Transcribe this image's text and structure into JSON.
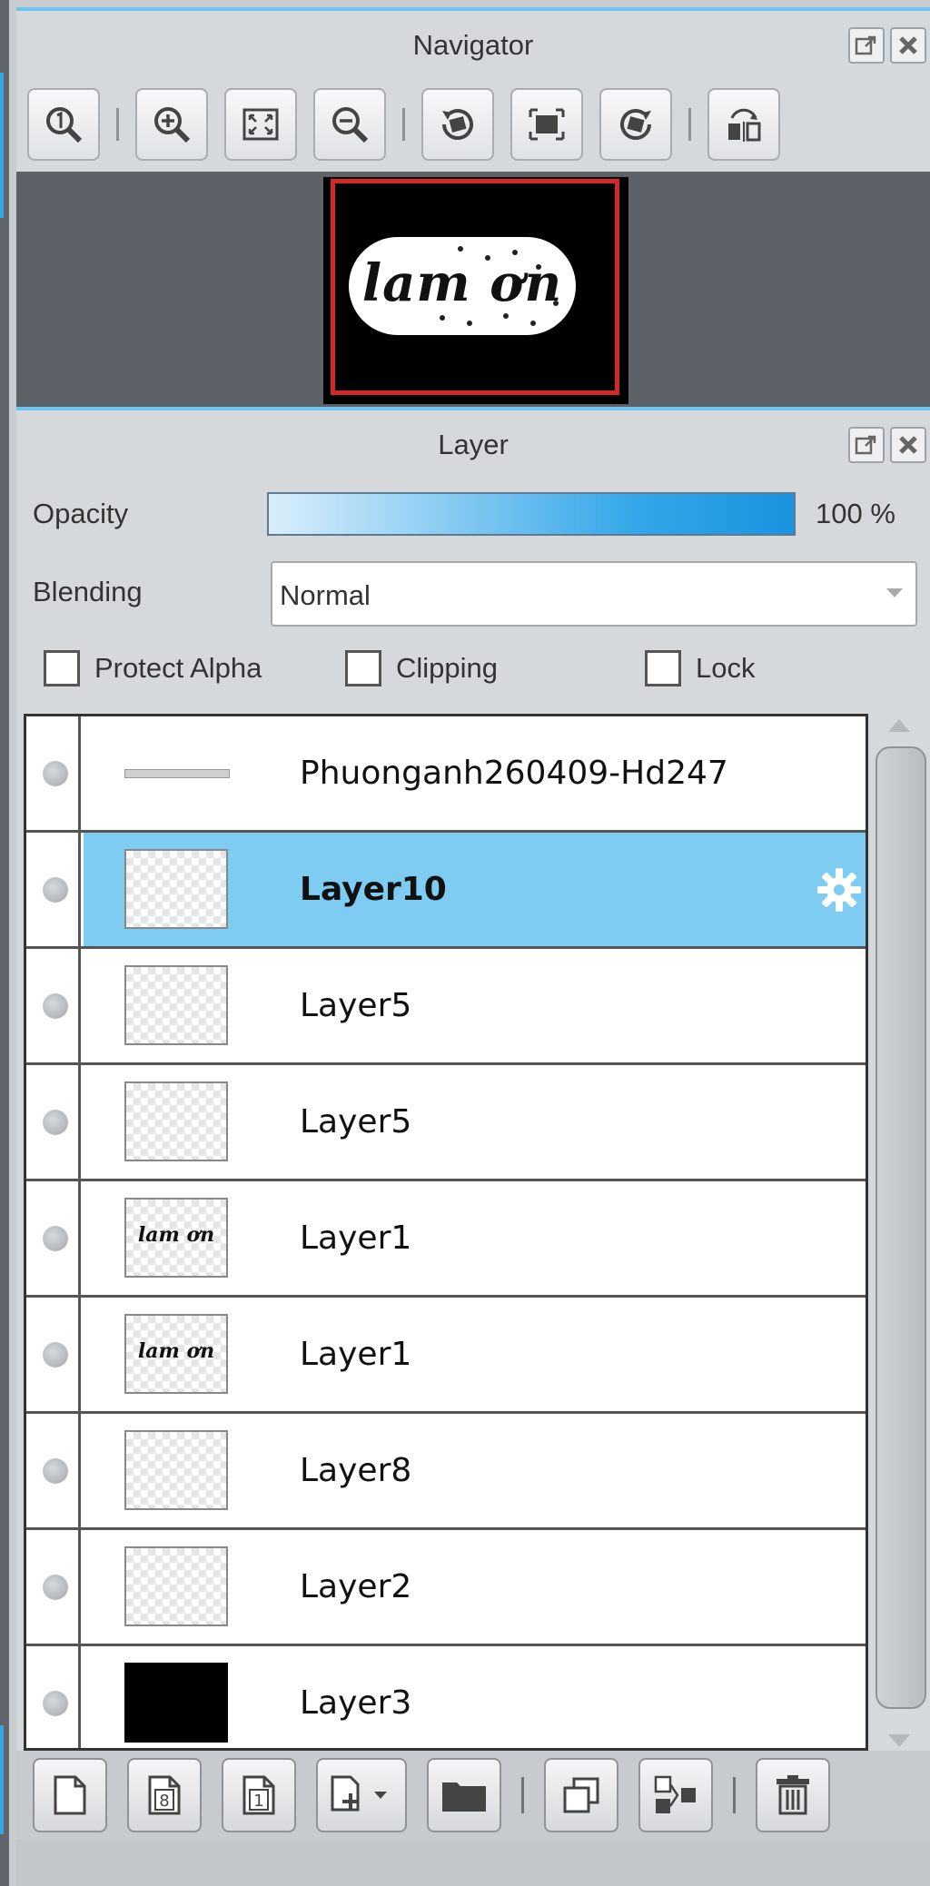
{
  "navigator": {
    "title": "Navigator",
    "toolbar": [
      {
        "name": "zoom-actual-icon"
      },
      {
        "name": "zoom-in-icon"
      },
      {
        "name": "fit-to-window-icon"
      },
      {
        "name": "zoom-out-icon"
      },
      {
        "name": "rotate-left-icon"
      },
      {
        "name": "fit-canvas-icon"
      },
      {
        "name": "rotate-right-icon"
      },
      {
        "name": "flip-horizontal-icon"
      }
    ],
    "preview": {
      "art_text": "lam ơn"
    }
  },
  "layer_panel": {
    "title": "Layer",
    "opacity_label": "Opacity",
    "opacity_value": "100 %",
    "opacity_fraction": 1.0,
    "blending_label": "Blending",
    "blending_value": "Normal",
    "protect_alpha_label": "Protect Alpha",
    "clipping_label": "Clipping",
    "lock_label": "Lock",
    "layers": [
      {
        "name": "Phuonganh260409-Hd247",
        "thumb": "line",
        "selected": false
      },
      {
        "name": "Layer10",
        "thumb": "transparent",
        "selected": true
      },
      {
        "name": "Layer5",
        "thumb": "transparent",
        "selected": false
      },
      {
        "name": "Layer5",
        "thumb": "transparent",
        "selected": false
      },
      {
        "name": "Layer1",
        "thumb": "text",
        "thumb_text": "lam ơn",
        "selected": false
      },
      {
        "name": "Layer1",
        "thumb": "text",
        "thumb_text": "lam ơn",
        "selected": false
      },
      {
        "name": "Layer8",
        "thumb": "transparent",
        "selected": false
      },
      {
        "name": "Layer2",
        "thumb": "transparent",
        "selected": false
      },
      {
        "name": "Layer3",
        "thumb": "black",
        "selected": false
      }
    ],
    "bottom_toolbar": [
      {
        "name": "new-layer-icon"
      },
      {
        "name": "new-8bit-layer-icon"
      },
      {
        "name": "new-1bit-layer-icon"
      },
      {
        "name": "add-layer-dropdown-icon"
      },
      {
        "name": "new-folder-icon"
      },
      {
        "name": "duplicate-layer-icon"
      },
      {
        "name": "merge-down-icon"
      },
      {
        "name": "delete-layer-icon"
      }
    ]
  },
  "colors": {
    "accent": "#33a6e8",
    "selected_row": "#7fccf3",
    "frame": "#d22828"
  }
}
